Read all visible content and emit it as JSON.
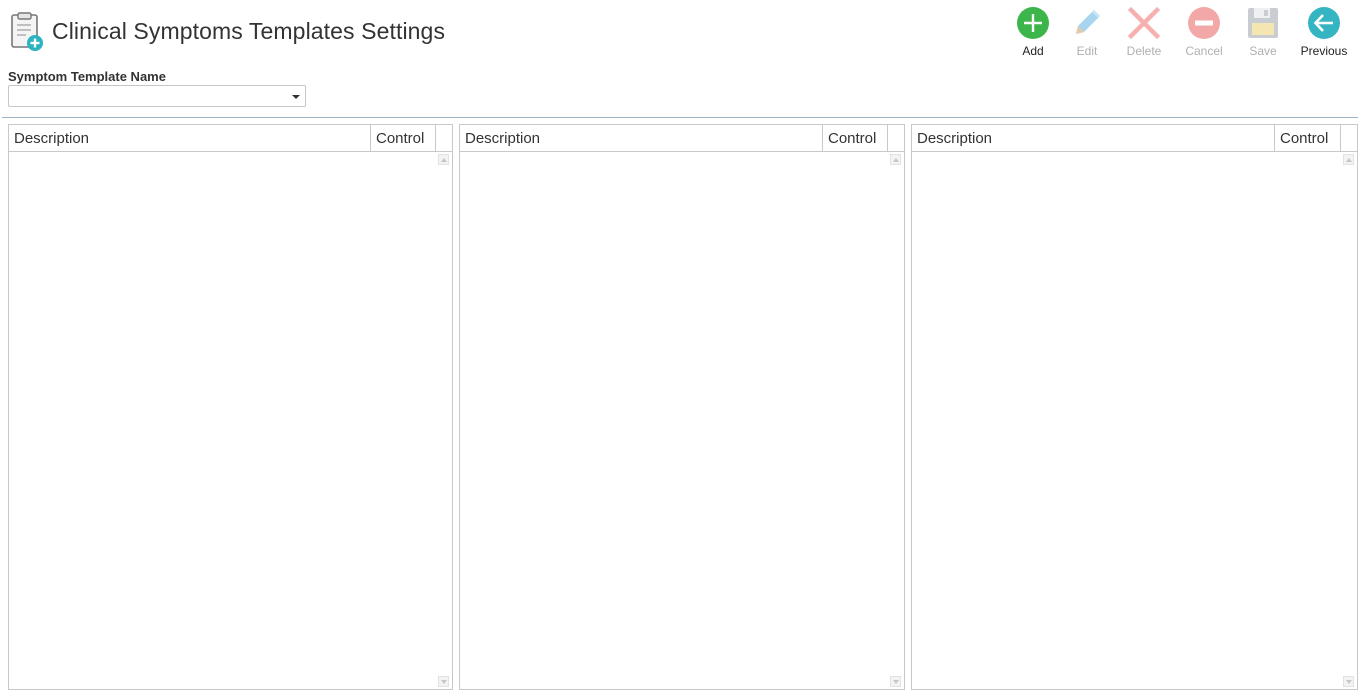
{
  "page": {
    "title": "Clinical Symptoms Templates Settings"
  },
  "toolbar": {
    "add": "Add",
    "edit": "Edit",
    "delete": "Delete",
    "cancel": "Cancel",
    "save": "Save",
    "previous": "Previous"
  },
  "form": {
    "template_name_label": "Symptom Template Name",
    "template_name_value": ""
  },
  "grids": [
    {
      "columns": [
        "Description",
        "Control"
      ],
      "rows": []
    },
    {
      "columns": [
        "Description",
        "Control"
      ],
      "rows": []
    },
    {
      "columns": [
        "Description",
        "Control"
      ],
      "rows": []
    }
  ],
  "colors": {
    "add": "#3cb54a",
    "edit": "#a7d4ee",
    "delete": "#f6b0b0",
    "cancel": "#f3a8a8",
    "save": "#c9cdd2",
    "previous": "#35b4c2",
    "divider": "#9fb4c6"
  }
}
